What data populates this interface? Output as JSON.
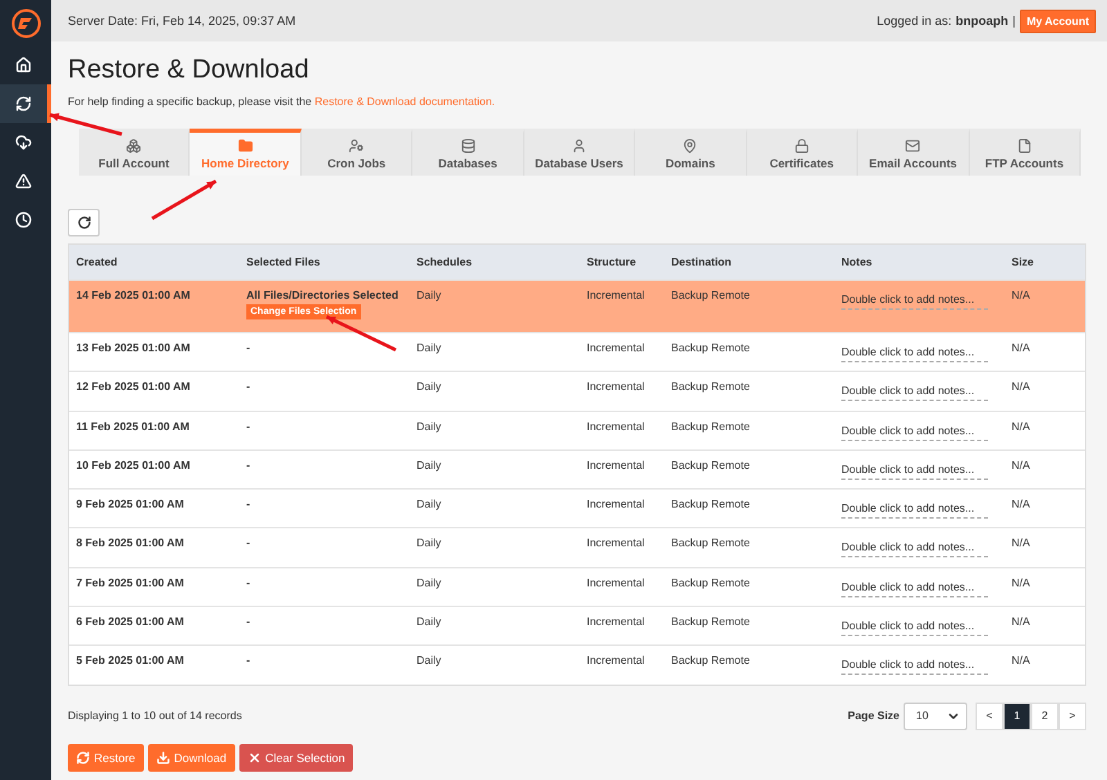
{
  "sidebar": {
    "items": [
      {
        "kind": "home",
        "selected": false
      },
      {
        "kind": "restore",
        "selected": true
      },
      {
        "kind": "download",
        "selected": false
      },
      {
        "kind": "alert",
        "selected": false
      },
      {
        "kind": "clock",
        "selected": false
      }
    ]
  },
  "top_bar": {
    "server_date": "Server Date: Fri, Feb 14, 2025, 09:37 AM",
    "logged_in_label": "Logged in as:",
    "username": "bnpoaph",
    "separator": "|",
    "account_button": "My Account"
  },
  "title": "Restore & Download",
  "help": {
    "text": "For help finding a specific backup, please visit the",
    "link": "Restore & Download documentation."
  },
  "tabs": [
    {
      "label": "Full Account",
      "kind": "account",
      "selected": false
    },
    {
      "label": "Home Directory",
      "kind": "folder",
      "selected": true
    },
    {
      "label": "Cron Jobs",
      "kind": "cron",
      "selected": false
    },
    {
      "label": "Databases",
      "kind": "database",
      "selected": false
    },
    {
      "label": "Database Users",
      "kind": "user",
      "selected": false
    },
    {
      "label": "Domains",
      "kind": "domain",
      "selected": false
    },
    {
      "label": "Certificates",
      "kind": "lock",
      "selected": false
    },
    {
      "label": "Email Accounts",
      "kind": "mail",
      "selected": false
    },
    {
      "label": "FTP Accounts",
      "kind": "file",
      "selected": false
    }
  ],
  "table": {
    "columns": [
      "Created",
      "Selected Files",
      "Schedules",
      "Structure",
      "Destination",
      "Notes",
      "Size"
    ],
    "rows": [
      {
        "created": "14 Feb 2025 01:00 AM",
        "selected_files": "All Files/Directories Selected",
        "action": "Change Files Selection",
        "schedule": "Daily",
        "structure": "Incremental",
        "destination": "Backup Remote",
        "notes": "Double click to add notes...",
        "size": "N/A",
        "selected": true
      },
      {
        "created": "13 Feb 2025 01:00 AM",
        "selected_files": "-",
        "schedule": "Daily",
        "structure": "Incremental",
        "destination": "Backup Remote",
        "notes": "Double click to add notes...",
        "size": "N/A",
        "selected": false
      },
      {
        "created": "12 Feb 2025 01:00 AM",
        "selected_files": "-",
        "schedule": "Daily",
        "structure": "Incremental",
        "destination": "Backup Remote",
        "notes": "Double click to add notes...",
        "size": "N/A",
        "selected": false
      },
      {
        "created": "11 Feb 2025 01:00 AM",
        "selected_files": "-",
        "schedule": "Daily",
        "structure": "Incremental",
        "destination": "Backup Remote",
        "notes": "Double click to add notes...",
        "size": "N/A",
        "selected": false
      },
      {
        "created": "10 Feb 2025 01:00 AM",
        "selected_files": "-",
        "schedule": "Daily",
        "structure": "Incremental",
        "destination": "Backup Remote",
        "notes": "Double click to add notes...",
        "size": "N/A",
        "selected": false
      },
      {
        "created": "9 Feb 2025 01:00 AM",
        "selected_files": "-",
        "schedule": "Daily",
        "structure": "Incremental",
        "destination": "Backup Remote",
        "notes": "Double click to add notes...",
        "size": "N/A",
        "selected": false
      },
      {
        "created": "8 Feb 2025 01:00 AM",
        "selected_files": "-",
        "schedule": "Daily",
        "structure": "Incremental",
        "destination": "Backup Remote",
        "notes": "Double click to add notes...",
        "size": "N/A",
        "selected": false
      },
      {
        "created": "7 Feb 2025 01:00 AM",
        "selected_files": "-",
        "schedule": "Daily",
        "structure": "Incremental",
        "destination": "Backup Remote",
        "notes": "Double click to add notes...",
        "size": "N/A",
        "selected": false
      },
      {
        "created": "6 Feb 2025 01:00 AM",
        "selected_files": "-",
        "schedule": "Daily",
        "structure": "Incremental",
        "destination": "Backup Remote",
        "notes": "Double click to add notes...",
        "size": "N/A",
        "selected": false
      },
      {
        "created": "5 Feb 2025 01:00 AM",
        "selected_files": "-",
        "schedule": "Daily",
        "structure": "Incremental",
        "destination": "Backup Remote",
        "notes": "Double click to add notes...",
        "size": "N/A",
        "selected": false
      }
    ]
  },
  "footer": {
    "records": "Displaying 1 to 10 out of 14 records",
    "page_size_label": "Page Size",
    "page_size": "10",
    "pages": [
      {
        "label": "<",
        "selected": false
      },
      {
        "label": "1",
        "selected": true
      },
      {
        "label": "2",
        "selected": false
      },
      {
        "label": ">",
        "selected": false
      }
    ]
  },
  "actions": [
    {
      "label": "Restore",
      "kind": "restore"
    },
    {
      "label": "Download",
      "kind": "download"
    },
    {
      "label": "Clear Selection",
      "kind": "clear"
    }
  ],
  "annotations": [
    {
      "kind": "sidebar"
    },
    {
      "kind": "tab"
    },
    {
      "kind": "action"
    }
  ]
}
